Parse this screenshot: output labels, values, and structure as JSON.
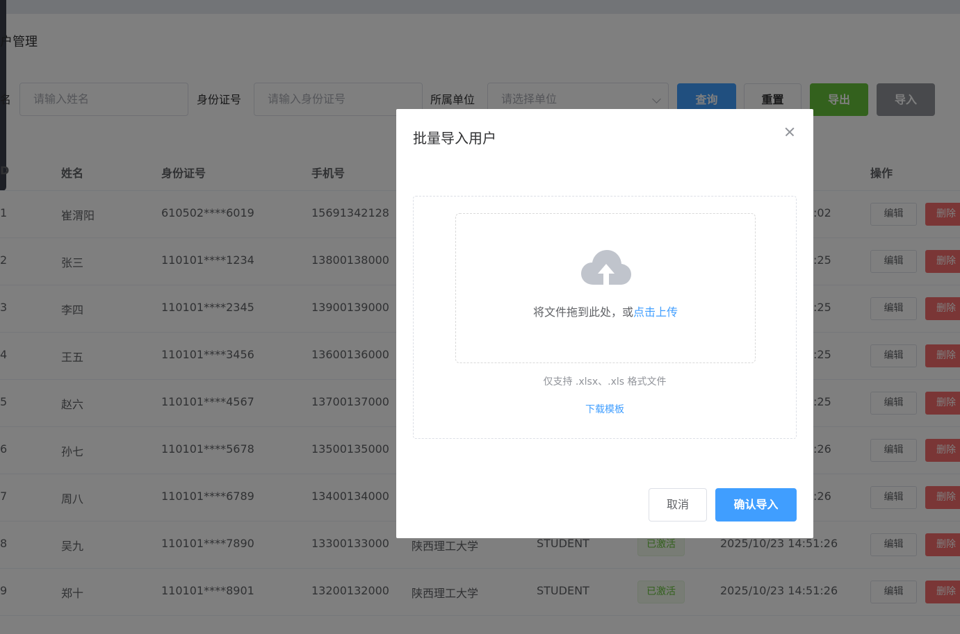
{
  "page": {
    "title": "户管理"
  },
  "search": {
    "name_label": "名",
    "name_placeholder": "请输入姓名",
    "id_label": "身份证号",
    "id_placeholder": "请输入身份证号",
    "unit_label": "所属单位",
    "unit_placeholder": "请选择单位",
    "query_button": "查询",
    "reset_button": "重置",
    "export_button": "导出",
    "import_button": "导入"
  },
  "table": {
    "headers": [
      "D",
      "姓名",
      "身份证号",
      "手机号",
      "操作"
    ],
    "rows": [
      {
        "id": "1",
        "name": "崔渭阳",
        "id_card": "610502****6019",
        "phone": "15691342128",
        "unit": "",
        "role": "",
        "status": "",
        "time": ":02"
      },
      {
        "id": "2",
        "name": "张三",
        "id_card": "110101****1234",
        "phone": "13800138000",
        "unit": "",
        "role": "",
        "status": "",
        "time": ":25"
      },
      {
        "id": "3",
        "name": "李四",
        "id_card": "110101****2345",
        "phone": "13900139000",
        "unit": "",
        "role": "",
        "status": "",
        "time": ":25"
      },
      {
        "id": "4",
        "name": "王五",
        "id_card": "110101****3456",
        "phone": "13600136000",
        "unit": "",
        "role": "",
        "status": "",
        "time": ":25"
      },
      {
        "id": "5",
        "name": "赵六",
        "id_card": "110101****4567",
        "phone": "13700137000",
        "unit": "",
        "role": "",
        "status": "",
        "time": ":25"
      },
      {
        "id": "6",
        "name": "孙七",
        "id_card": "110101****5678",
        "phone": "13500135000",
        "unit": "",
        "role": "",
        "status": "",
        "time": ":26"
      },
      {
        "id": "7",
        "name": "周八",
        "id_card": "110101****6789",
        "phone": "13400134000",
        "unit": "",
        "role": "",
        "status": "",
        "time": ":26"
      },
      {
        "id": "8",
        "name": "吴九",
        "id_card": "110101****7890",
        "phone": "13300133000",
        "unit": "陕西理工大学",
        "role": "STUDENT",
        "status": "已激活",
        "time": "2025/10/23 14:51:26"
      },
      {
        "id": "9",
        "name": "郑十",
        "id_card": "110101****8901",
        "phone": "13200132000",
        "unit": "陕西理工大学",
        "role": "STUDENT",
        "status": "已激活",
        "time": "2025/10/23 14:51:26"
      }
    ],
    "edit_label": "编辑",
    "delete_label": "删除"
  },
  "dialog": {
    "title": "批量导入用户",
    "drag_text": "将文件拖到此处，或",
    "upload_link": "点击上传",
    "tip": "仅支持 .xlsx、.xls 格式文件",
    "template_link": "下载模板",
    "cancel_button": "取消",
    "confirm_button": "确认导入",
    "icons": {
      "close": "close-icon",
      "upload": "cloud-upload-icon"
    }
  },
  "colors": {
    "primary": "#409eff",
    "success": "#67c23a",
    "info": "#909399",
    "danger": "#f56c6c"
  }
}
